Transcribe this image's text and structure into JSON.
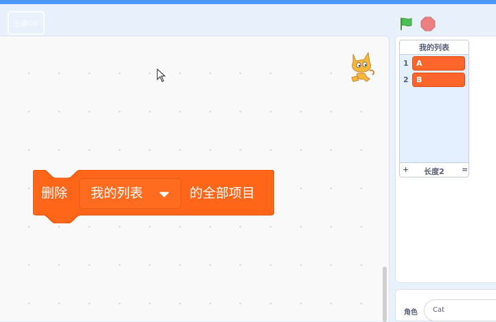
{
  "header": {
    "logo_text": "迅速GIF",
    "green_flag_icon": "green-flag-icon",
    "stop_icon": "stop-icon",
    "colors": {
      "flag": "#4cbf56",
      "stop": "#ec5959"
    }
  },
  "workspace": {
    "block": {
      "prefix": "删除",
      "dropdown_value": "我的列表",
      "suffix": "的全部项目",
      "color": "#ff661a"
    }
  },
  "list_monitor": {
    "title": "我的列表",
    "items": [
      {
        "index": "1",
        "value": "A"
      },
      {
        "index": "2",
        "value": "B"
      }
    ],
    "add_label": "+",
    "length_label": "长度2",
    "resize_label": "="
  },
  "sprite_panel": {
    "label": "角色",
    "name_value": "Cat"
  }
}
